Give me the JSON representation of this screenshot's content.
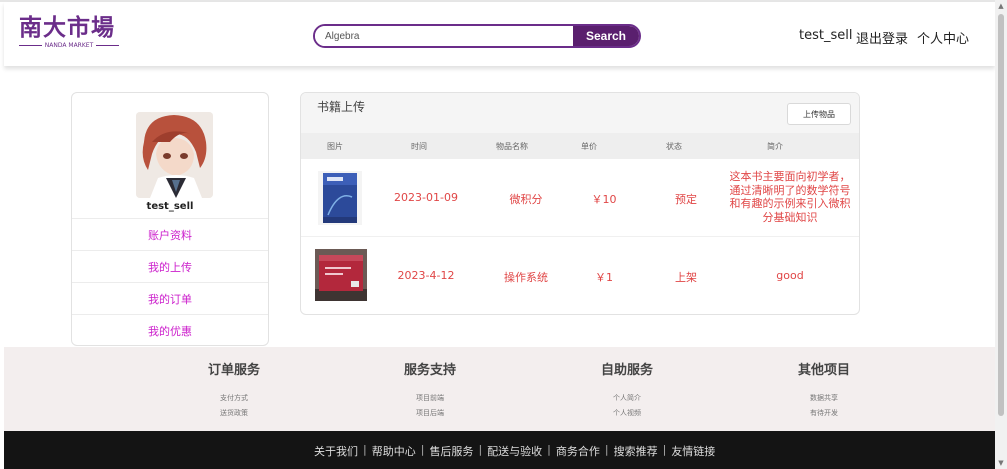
{
  "header": {
    "logo_text": "南大市場",
    "logo_subtitle": "NANDA MARKET",
    "search_value": "Algebra",
    "search_button": "Search",
    "username": "test_sell",
    "logout": "退出登录",
    "profile": "个人中心"
  },
  "sidebar": {
    "username": "test_sell",
    "items": [
      {
        "label": "账户资料"
      },
      {
        "label": "我的上传"
      },
      {
        "label": "我的订单"
      },
      {
        "label": "我的优惠"
      }
    ]
  },
  "main": {
    "title": "书籍上传",
    "upload_button": "上传物品",
    "columns": [
      "图片",
      "时间",
      "物品名称",
      "单价",
      "状态",
      "简介"
    ],
    "rows": [
      {
        "date": "2023-01-09",
        "name": "微积分",
        "price": "￥10",
        "status": "预定",
        "intro": "这本书主要面向初学者，通过清晰明了的数学符号和有趣的示例来引入微积分基础知识"
      },
      {
        "date": "2023-4-12",
        "name": "操作系统",
        "price": "￥1",
        "status": "上架",
        "intro": "good"
      }
    ]
  },
  "footer": {
    "columns": [
      {
        "title": "订单服务",
        "links": [
          "支付方式",
          "送货政策"
        ]
      },
      {
        "title": "服务支持",
        "links": [
          "项目前端",
          "项目后端"
        ]
      },
      {
        "title": "自助服务",
        "links": [
          "个人简介",
          "个人视频"
        ]
      },
      {
        "title": "其他项目",
        "links": [
          "数据共享",
          "有待开发"
        ]
      }
    ],
    "nav": [
      "关于我们",
      "帮助中心",
      "售后服务",
      "配送与验收",
      "商务合作",
      "搜索推荐",
      "友情链接"
    ]
  },
  "colors": {
    "brand": "#6b2d8a",
    "search_button_bg": "#5a1f6e",
    "menu_link": "#cc1fcc",
    "row_text": "#e04646",
    "footer_top_bg": "#f3eeee",
    "footer_bottom_bg": "#141414"
  },
  "icons": {
    "scroll_up": "▲",
    "scroll_down": "▼"
  }
}
